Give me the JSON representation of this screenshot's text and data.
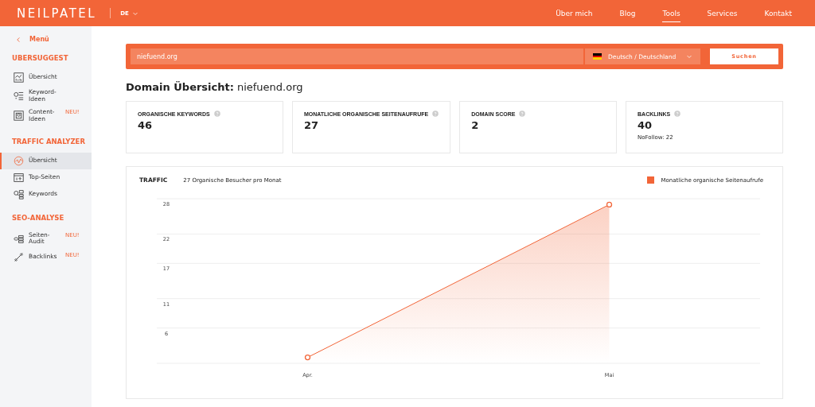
{
  "header": {
    "logo": "NEILPATEL",
    "language": "DE",
    "nav": [
      {
        "label": "Über mich",
        "selected": false
      },
      {
        "label": "Blog",
        "selected": false
      },
      {
        "label": "Tools",
        "selected": true
      },
      {
        "label": "Services",
        "selected": false
      },
      {
        "label": "Kontakt",
        "selected": false
      }
    ]
  },
  "sidebar": {
    "back": "Menü",
    "sections": [
      {
        "title": "UBERSUGGEST",
        "items": [
          {
            "label": "Übersicht",
            "selected": false
          },
          {
            "label": "Keyword-Ideen",
            "selected": false
          },
          {
            "label": "Content-Ideen",
            "badge": "NEU!",
            "selected": false
          }
        ]
      },
      {
        "title": "TRAFFIC ANALYZER",
        "items": [
          {
            "label": "Übersicht",
            "selected": true
          },
          {
            "label": "Top-Seiten",
            "selected": false
          },
          {
            "label": "Keywords",
            "selected": false
          }
        ]
      },
      {
        "title": "SEO-ANALYSE",
        "items": [
          {
            "label": "Seiten-Audit",
            "badge": "NEU!",
            "selected": false
          },
          {
            "label": "Backlinks",
            "badge": "NEU!",
            "selected": false
          }
        ]
      }
    ]
  },
  "search": {
    "value": "niefuend.org",
    "language": "Deutsch / Deutschland",
    "button": "Suchen"
  },
  "heading": {
    "label": "Domain Übersicht:",
    "domain": "niefuend.org"
  },
  "stats": [
    {
      "label": "ORGANISCHE KEYWORDS",
      "value": "46"
    },
    {
      "label": "MONATLICHE ORGANISCHE SEITENAUFRUFE",
      "value": "27"
    },
    {
      "label": "DOMAIN SCORE",
      "value": "2"
    },
    {
      "label": "BACKLINKS",
      "value": "40",
      "note": "NoFollow: 22"
    }
  ],
  "traffic": {
    "title": "TRAFFIC",
    "subtitle": "27 Organische Besucher pro Monat",
    "chart_data": {
      "type": "area",
      "grid": true,
      "categories": [
        "Apr.",
        "Mai"
      ],
      "ylim": [
        0,
        28
      ],
      "yticks": [
        6,
        11,
        17,
        22,
        28
      ],
      "series": [
        {
          "name": "Monatliche organische Seitenaufrufe",
          "color": "#f26538",
          "values": [
            1,
            27
          ]
        }
      ]
    }
  }
}
